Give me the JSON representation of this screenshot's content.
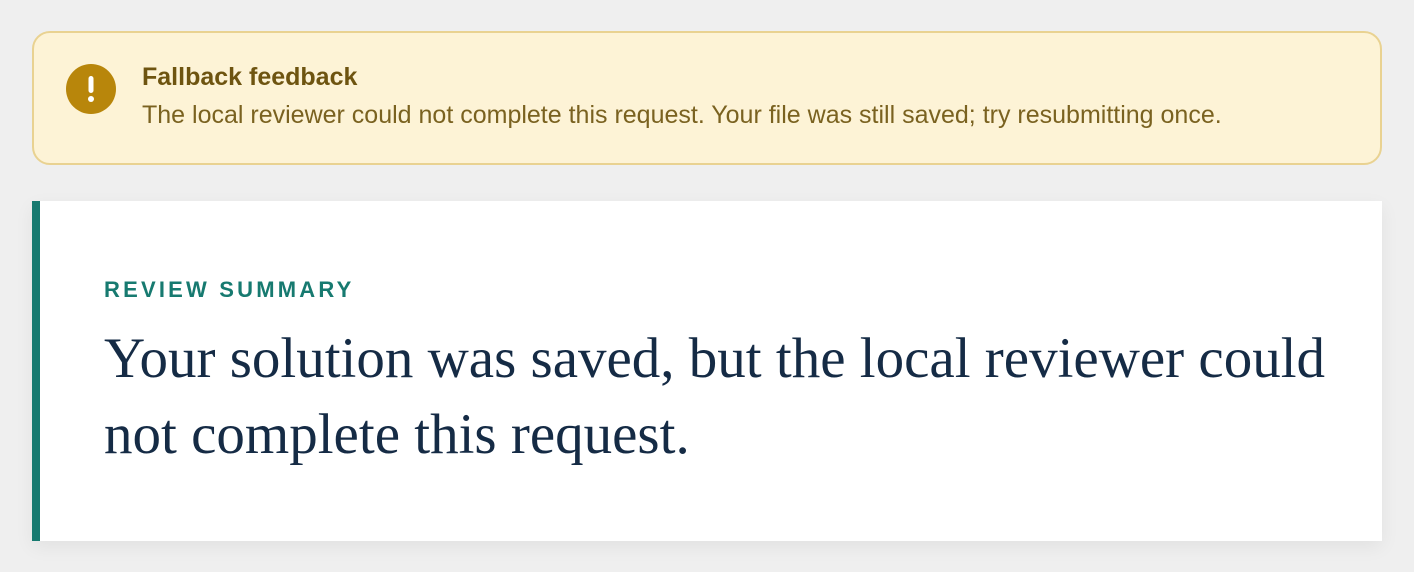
{
  "alert": {
    "icon": "exclamation-icon",
    "icon_glyph": "!",
    "title": "Fallback feedback",
    "message": "The local reviewer could not complete this request. Your file was still saved; try resubmitting once.",
    "colors": {
      "background": "#fdf3d6",
      "border": "#e9d291",
      "icon": "#b8860b",
      "text": "#7a6220"
    }
  },
  "review": {
    "eyebrow": "REVIEW SUMMARY",
    "summary": "Your solution was saved, but the local reviewer could not complete this request.",
    "colors": {
      "accent": "#177a70",
      "heading": "#152b45",
      "background": "#ffffff"
    }
  }
}
